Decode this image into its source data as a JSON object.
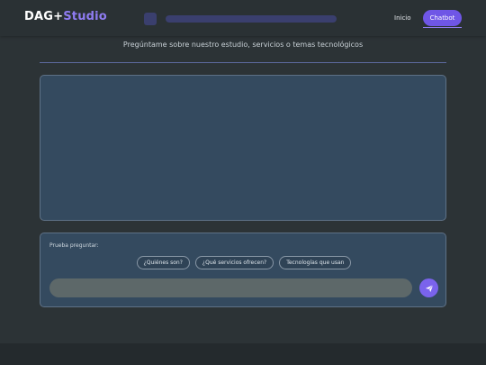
{
  "brand": {
    "part1": "DAG+",
    "part2": "Studio"
  },
  "nav": {
    "home_label": "Inicio",
    "chatbot_label": "Chatbot"
  },
  "subtitle": "Pregúntame sobre nuestro estudio, servicios o temas tecnológicos",
  "suggestions": {
    "label": "Prueba preguntar:",
    "chips": [
      "¿Quiénes son?",
      "¿Qué servicios ofrecen?",
      "Tecnologías que usan"
    ]
  },
  "colors": {
    "accent": "#6f56e6",
    "background": "#2c3336",
    "panel": "#344a5f"
  },
  "icons": {
    "send": "paper-plane-icon"
  }
}
